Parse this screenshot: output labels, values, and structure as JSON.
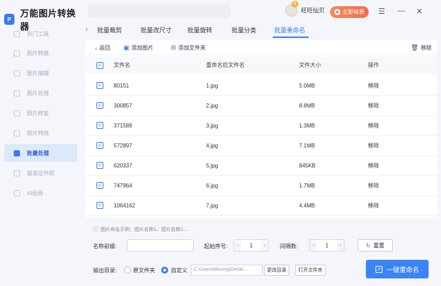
{
  "app": {
    "title": "万能图片转换器",
    "logo_glyph": "P"
  },
  "sidebar": {
    "items": [
      {
        "label": "热门工具",
        "active": false
      },
      {
        "label": "图片转换",
        "active": false
      },
      {
        "label": "图片编辑",
        "active": false
      },
      {
        "label": "图片处理",
        "active": false
      },
      {
        "label": "照片修复",
        "active": false
      },
      {
        "label": "照片特效",
        "active": false
      },
      {
        "label": "批量处理",
        "active": true
      },
      {
        "label": "最美证件照",
        "active": false
      },
      {
        "label": "AI绘画",
        "active": false
      }
    ]
  },
  "user": {
    "name": "旺旺仙贝",
    "vip_badge": "V",
    "renew_label": "立即续费"
  },
  "tabs": [
    "批量裁剪",
    "批量改尺寸",
    "批量旋转",
    "批量分类",
    "批量重命名"
  ],
  "toolbar": {
    "back_label": "返回",
    "add_image_label": "添加图片",
    "add_folder_label": "添加文件夹",
    "remove_label": "移除"
  },
  "table": {
    "headers": [
      "文件名",
      "重命名后文件名",
      "文件大小",
      "操作"
    ],
    "rows": [
      {
        "name": "80151",
        "new_name": "1.jpg",
        "size": "5.0MB",
        "action": "移除"
      },
      {
        "name": "300857",
        "new_name": "2.jpg",
        "size": "8.8MB",
        "action": "移除"
      },
      {
        "name": "371589",
        "new_name": "3.jpg",
        "size": "1.3MB",
        "action": "移除"
      },
      {
        "name": "572897",
        "new_name": "4.jpg",
        "size": "7.1MB",
        "action": "移除"
      },
      {
        "name": "620337",
        "new_name": "5.jpg",
        "size": "845KB",
        "action": "移除"
      },
      {
        "name": "747964",
        "new_name": "6.jpg",
        "size": "1.7MB",
        "action": "移除"
      },
      {
        "name": "1064162",
        "new_name": "7.jpg",
        "size": "4.4MB",
        "action": "移除"
      }
    ]
  },
  "rename": {
    "hint": "图片命名示例：图片名称1、图片名称2...",
    "prefix_label": "名称前缀:",
    "prefix_value": "",
    "start_label": "起始序号:",
    "start_value": "1",
    "interval_label": "间隔数:",
    "interval_value": "1",
    "reset_label": "重置"
  },
  "output": {
    "label": "输出目录:",
    "option_original": "原文件夹",
    "option_custom": "自定义",
    "path": "C:\\Users\\Mloong\\Deskt...",
    "change_label": "更改目录",
    "open_label": "打开文件夹",
    "selected": "custom"
  },
  "primary_button": "一键重命名",
  "colors": {
    "accent": "#3a7af0",
    "renew": "#f26b4a"
  }
}
